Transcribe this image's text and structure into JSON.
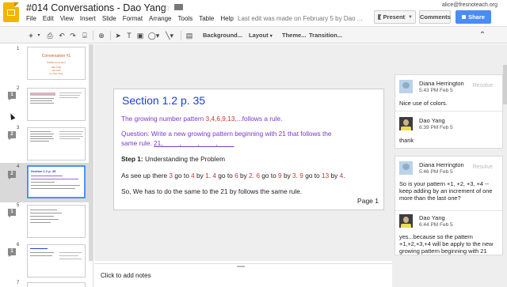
{
  "header": {
    "title": "#014 Conversations - Dao Yang",
    "menu": [
      "File",
      "Edit",
      "View",
      "Insert",
      "Slide",
      "Format",
      "Arrange",
      "Tools",
      "Table",
      "Help"
    ],
    "last_edit": "Last edit was made on February 5 by Dao ...",
    "account": "alice@fresnoteach.org",
    "present_label": "Present",
    "comments_label": "Comments",
    "share_label": "Share"
  },
  "toolbar": {
    "add_label": "+",
    "background_label": "Background...",
    "layout_label": "Layout",
    "theme_label": "Theme...",
    "transition_label": "Transition...",
    "collapse_label": "⌃"
  },
  "filmstrip": {
    "slides": [
      {
        "num": "1",
        "badge": ""
      },
      {
        "num": "2",
        "badge": "1"
      },
      {
        "num": "3",
        "badge": "2"
      },
      {
        "num": "4",
        "badge": "2"
      },
      {
        "num": "5",
        "badge": "1"
      },
      {
        "num": "6",
        "badge": "1"
      },
      {
        "num": "7",
        "badge": ""
      }
    ],
    "slide1_title": "Conversation #1",
    "slide1_sub1": "Subtitle Goes Here",
    "slide1_sub2": "Dao Yang",
    "slide1_sub3": "Jan 12th",
    "slide1_sub4": "by: Dao Yang",
    "slide4_title": "Section 1.2 p. 35"
  },
  "slide": {
    "title": "Section 1.2 p. 35",
    "line1_prefix": "The growing number pattern ",
    "line1_numbers": "3,4,6,9,13",
    "line1_suffix": ",...follows a rule.",
    "line2": "Question: Write a new growing pattern beginning with 21 that follows the",
    "line3_prefix": "same rule. ",
    "line3_blanks": "21, ____, ____, ____, ____",
    "step_label": "Step 1:",
    "step_text": " Understanding the Problem",
    "line5_a": "As see up there ",
    "line5_3": "3",
    "line5_b": " go to ",
    "line5_4": "4",
    "line5_c": " by ",
    "line5_1": "1",
    "line5_d": ". ",
    "line5_4b": "4",
    "line5_e": " go to ",
    "line5_6": "6",
    "line5_f": " by ",
    "line5_2": "2",
    "line5_g": ". ",
    "line5_6b": "6",
    "line5_h": " go to ",
    "line5_9": "9",
    "line5_i": " by ",
    "line5_3b": "3",
    "line5_j": ". ",
    "line5_9b": "9",
    "line5_k": " go to ",
    "line5_13": "13",
    "line5_l": " by ",
    "line5_4c": "4",
    "line5_m": ".",
    "line6": "So, We has to do the same to the 21 by follows the same rule.",
    "page_label": "Page 1"
  },
  "notes": {
    "placeholder": "Click to add notes"
  },
  "comments": {
    "thread1": [
      {
        "name": "Diana Herrington",
        "time": "5:43 PM Feb 5",
        "text": "Nice use of colors.",
        "resolve": "Resolve"
      },
      {
        "name": "Dao Yang",
        "time": "6:39 PM Feb 5",
        "text": "thank"
      }
    ],
    "thread2": [
      {
        "name": "Diana Herrington",
        "time": "5:46 PM Feb 5",
        "text": "So is your pattern +1, +2, +3, +4 -- keep adding by an increment of one more than the last one?",
        "resolve": "Resolve"
      },
      {
        "name": "Dao Yang",
        "time": "6:44 PM Feb 5",
        "text": "yes...because so the pattern +1,+2,+3,+4 will be apply to the new growing pattern beginning with 21"
      }
    ]
  }
}
